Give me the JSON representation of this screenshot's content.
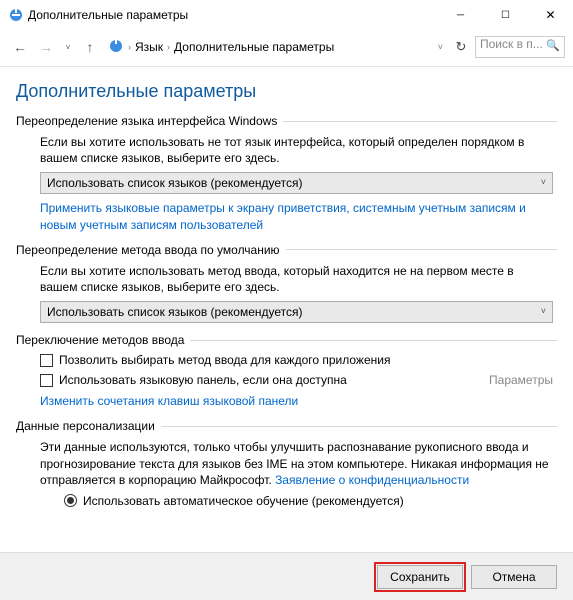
{
  "window": {
    "title": "Дополнительные параметры"
  },
  "nav": {
    "crumb1": "Язык",
    "crumb2": "Дополнительные параметры",
    "search_placeholder": "Поиск в п..."
  },
  "page": {
    "heading": "Дополнительные параметры"
  },
  "section_ui": {
    "label": "Переопределение языка интерфейса Windows",
    "hint": "Если вы хотите использовать не тот язык интерфейса, который определен порядком в вашем списке языков, выберите его здесь.",
    "select": "Использовать список языков (рекомендуется)",
    "link": "Применить языковые параметры к экрану приветствия, системным учетным записям и новым учетным записям пользователей"
  },
  "section_input": {
    "label": "Переопределение метода ввода по умолчанию",
    "hint": "Если вы хотите использовать метод ввода, который находится не на первом месте в вашем списке языков, выберите его здесь.",
    "select": "Использовать список языков (рекомендуется)"
  },
  "section_switch": {
    "label": "Переключение методов ввода",
    "chk1": "Позволить выбирать метод ввода для каждого приложения",
    "chk2": "Использовать языковую панель, если она доступна",
    "params": "Параметры",
    "link": "Изменить сочетания клавиш языковой панели"
  },
  "section_personal": {
    "label": "Данные персонализации",
    "hint_prefix": "Эти данные используются, только чтобы улучшить распознавание рукописного ввода и прогнозирование текста для языков без IME на этом компьютере. Никакая информация не отправляется в корпорацию Майкрософт. ",
    "privacy_link": "Заявление о конфиденциальности",
    "radio": "Использовать автоматическое обучение (рекомендуется)"
  },
  "buttons": {
    "save": "Сохранить",
    "cancel": "Отмена"
  }
}
